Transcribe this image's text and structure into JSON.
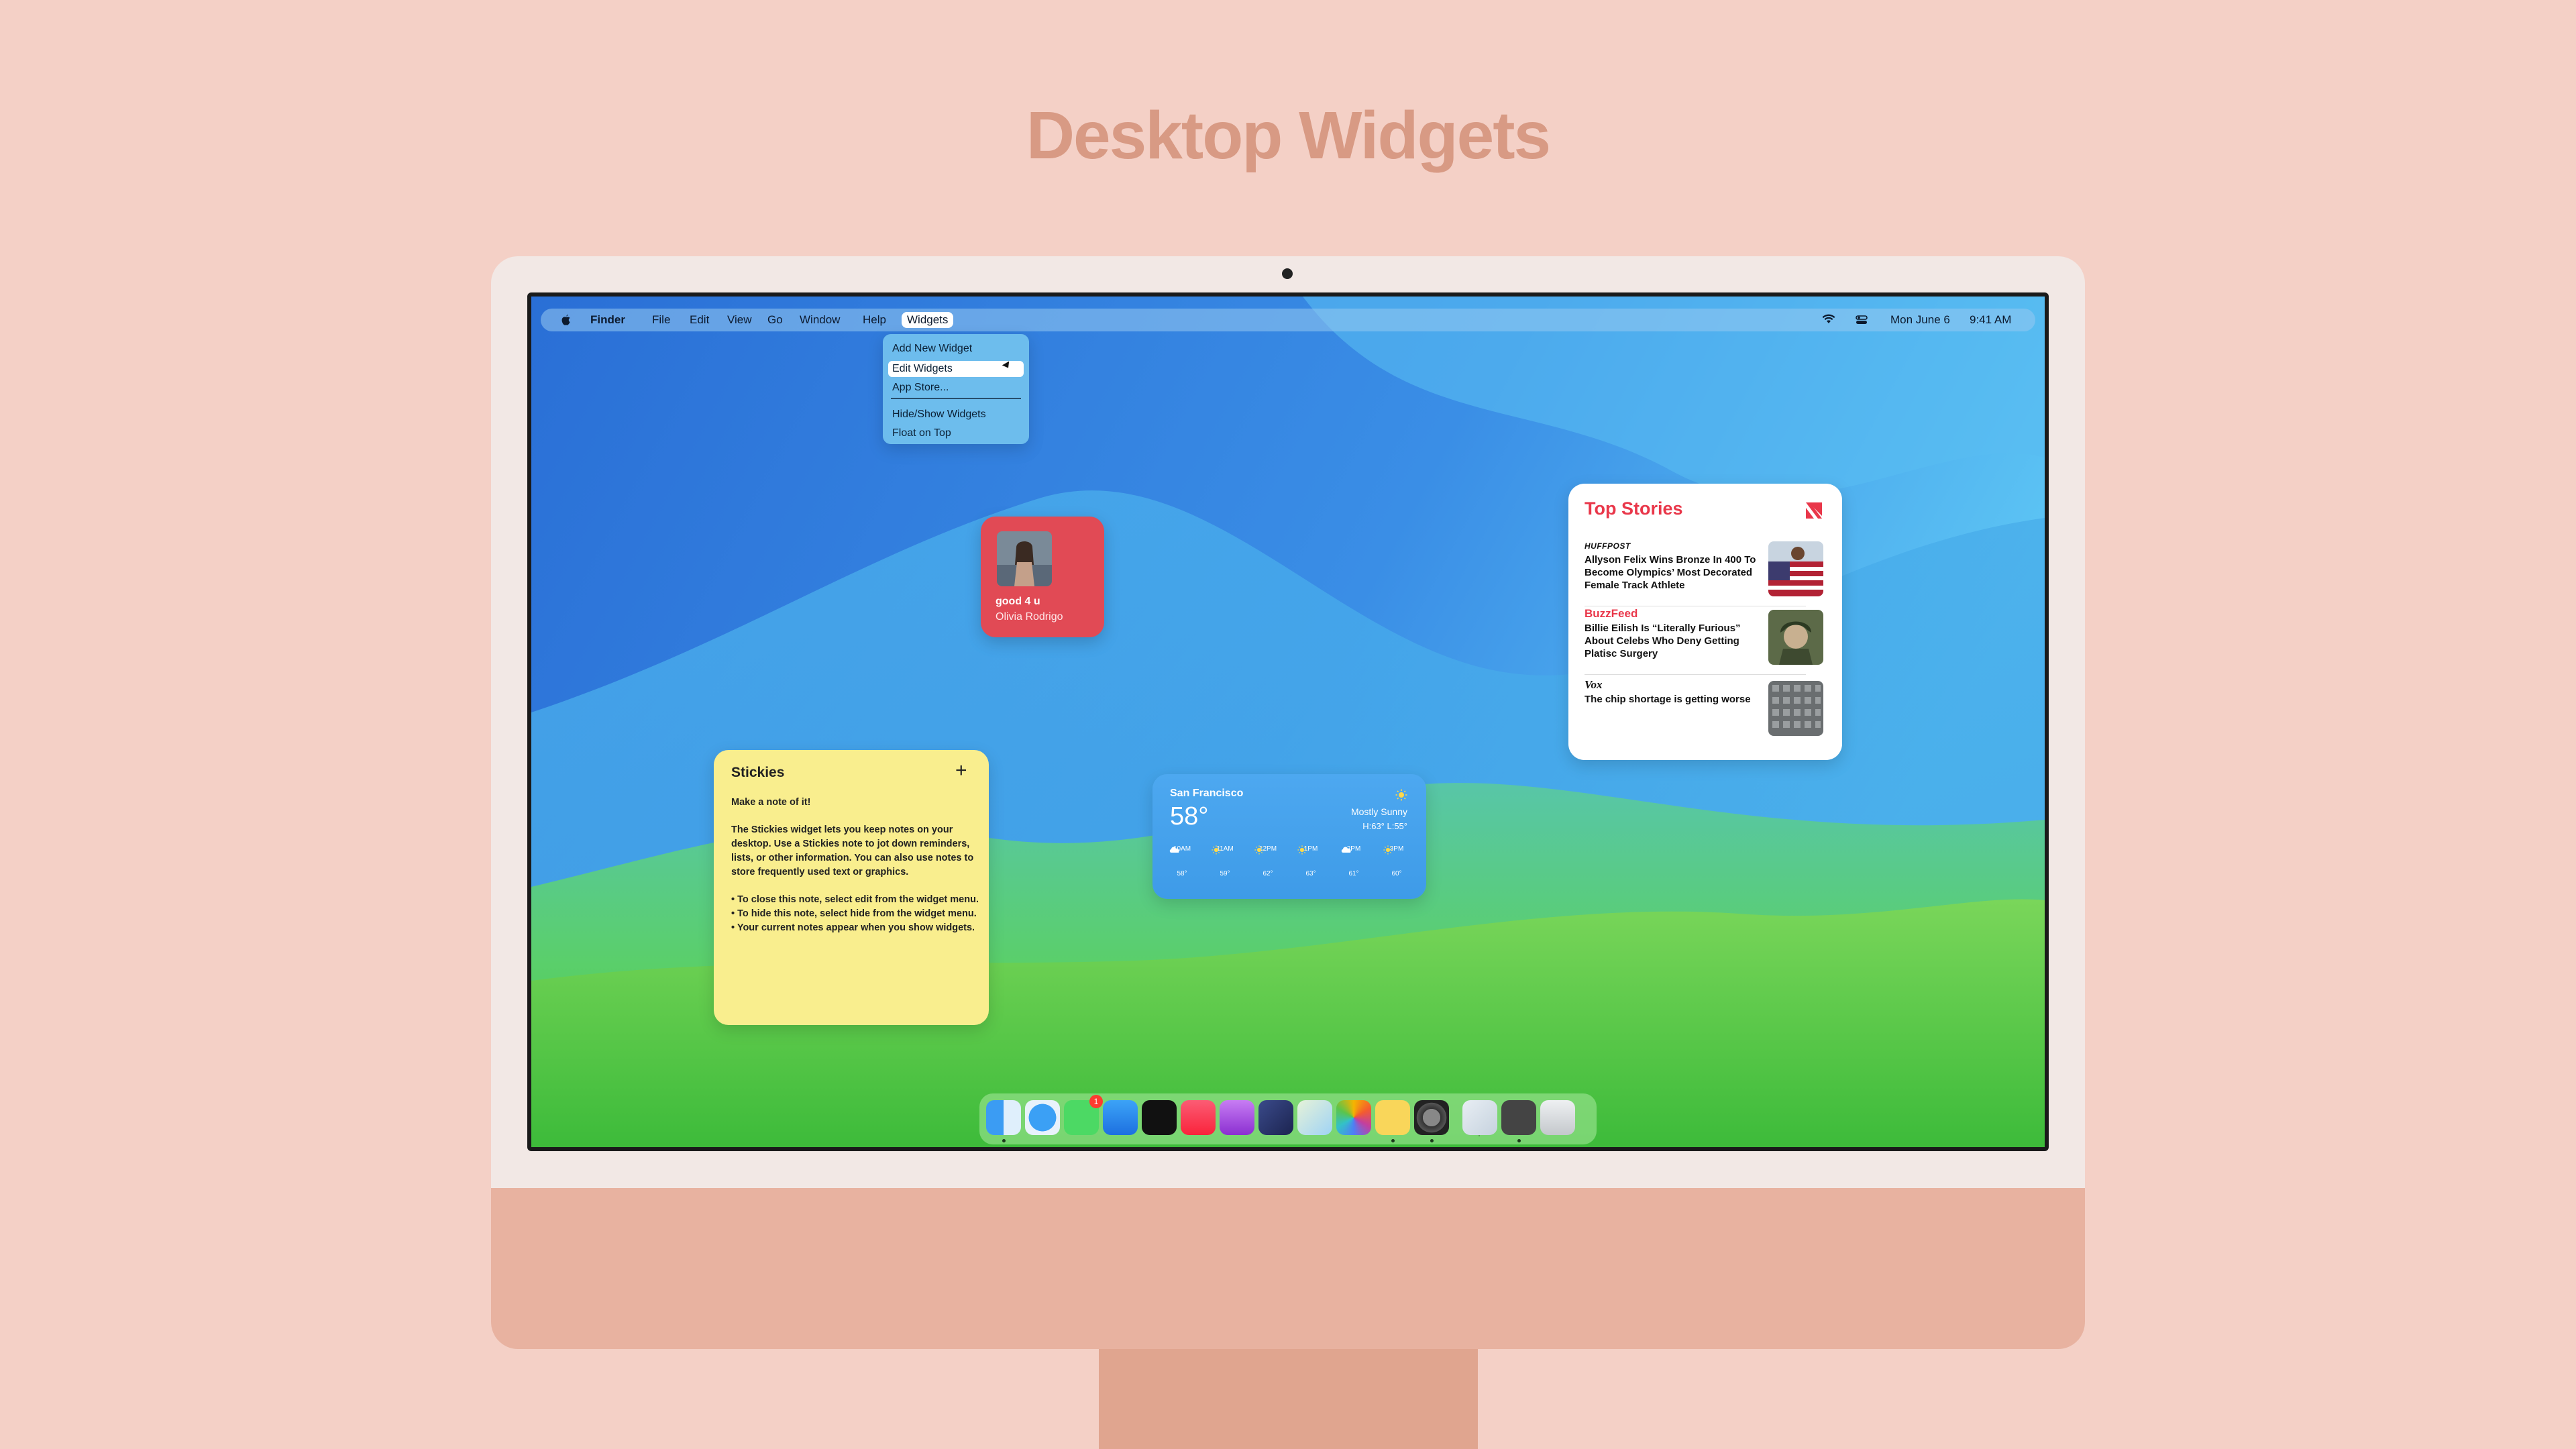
{
  "page": {
    "title": "Desktop Widgets"
  },
  "menubar": {
    "app_name": "Finder",
    "menus": [
      "File",
      "Edit",
      "View",
      "Go",
      "Window",
      "Help",
      "Widgets"
    ],
    "date": "Mon June 6",
    "time": "9:41 AM"
  },
  "widgets_menu": {
    "items": [
      "Add New Widget",
      "Edit Widgets",
      "App Store...",
      "Hide/Show Widgets",
      "Float on Top"
    ],
    "highlighted": "Edit Widgets"
  },
  "music_widget": {
    "song": "good 4 u",
    "artist": "Olivia Rodrigo",
    "color": "#e14a55"
  },
  "news_widget": {
    "title": "Top Stories",
    "stories": [
      {
        "source": "HUFFPOST",
        "headline": "Allyson Felix Wins Bronze In 400 To Become Olympics’ Most Decorated Female Track Athlete"
      },
      {
        "source": "BuzzFeed",
        "headline": "Billie Eilish Is “Literally Furious” About Celebs Who Deny Getting Platisc Surgery"
      },
      {
        "source": "Vox",
        "headline": "The chip shortage is getting worse"
      }
    ]
  },
  "stickies_widget": {
    "title": "Stickies",
    "heading": "Make a note of it!",
    "paragraph": "The Stickies widget lets you keep notes on your desktop. Use a Stickies note to jot down reminders, lists, or other information. You can also use notes to store frequently used text or graphics.",
    "bullets": [
      "• To close this note, select edit from the widget menu.",
      "• To hide this note, select hide from the widget menu.",
      "• Your current notes appear when you show widgets."
    ]
  },
  "weather_widget": {
    "city": "San Francisco",
    "temp": "58°",
    "condition": "Mostly Sunny",
    "high_low": "H:63° L:55°",
    "hourly": [
      {
        "time": "10AM",
        "icon": "cloud-icon",
        "temp": "58°"
      },
      {
        "time": "11AM",
        "icon": "sun-icon",
        "temp": "59°"
      },
      {
        "time": "12PM",
        "icon": "sun-icon",
        "temp": "62°"
      },
      {
        "time": "1PM",
        "icon": "sun-icon",
        "temp": "63°"
      },
      {
        "time": "2PM",
        "icon": "cloud-icon",
        "temp": "61°"
      },
      {
        "time": "3PM",
        "icon": "sun-icon",
        "temp": "60°"
      }
    ]
  },
  "dock": {
    "apps": [
      "Finder",
      "Safari",
      "Messages",
      "Mail",
      "Apple TV",
      "Music",
      "Podcasts",
      "Shortcuts",
      "Maps",
      "Photos",
      "Home",
      "System Preferences",
      "App Library",
      "Widget Editor",
      "Trash"
    ],
    "messages_badge": "1"
  }
}
